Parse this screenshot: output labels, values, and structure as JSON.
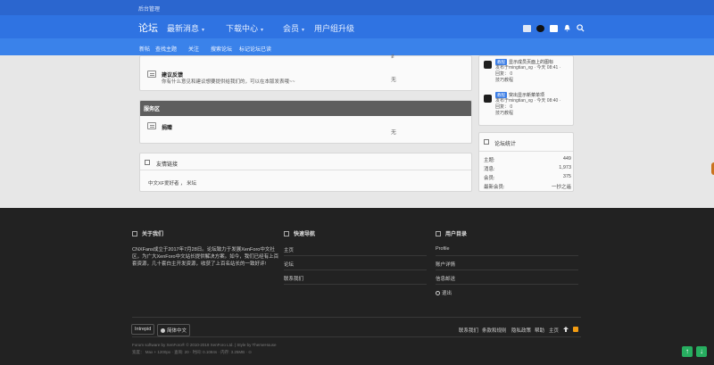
{
  "header": {
    "admin_link": "后台管理",
    "nav": [
      {
        "label": "论坛"
      },
      {
        "label": "最新消息"
      },
      {
        "label": "下载中心"
      },
      {
        "label": "会员"
      },
      {
        "label": "用户组升级"
      }
    ],
    "chev": "▾",
    "subnav": [
      "新帖",
      "查找主题",
      "关注",
      "搜索论坛",
      "标记论坛已读"
    ]
  },
  "main": {
    "node_suggest": {
      "title": "建议反馈",
      "desc": "你有什么意见和建议想要提供给我们的，可以在本版发表哦~~",
      "stat": "无"
    },
    "category_service": {
      "title": "服务区"
    },
    "node_donate": {
      "title": "捐赠",
      "stat": "无"
    },
    "friend_links": {
      "title": "友情链接",
      "links": "中文XF爱好者 ， 米坛"
    }
  },
  "sidebar": {
    "threads": [
      {
        "badge": "教程",
        "title": "显示成员页面上的图标",
        "meta1": "发布于mingtian_xg · 今天 08:41 ·",
        "meta2": "回复： 0",
        "meta3": "技巧教程"
      },
      {
        "badge": "教程",
        "title": "突出显示新菜单项",
        "meta1": "发布于mingtian_xg · 今天 08:40 ·",
        "meta2": "回复： 0",
        "meta3": "技巧教程"
      }
    ],
    "stats": {
      "title": "论坛统计",
      "rows": [
        {
          "label": "主题:",
          "value": "449"
        },
        {
          "label": "消息:",
          "value": "1,973"
        },
        {
          "label": "会员:",
          "value": "375"
        },
        {
          "label": "最新会员:",
          "value": "一抄之遥"
        }
      ]
    }
  },
  "footer": {
    "about": {
      "title": "关于我们",
      "text1": "CNXFans成立于2017年7月28日。论坛致力于发展XenForo中文社",
      "text2": "区，为广大XenForo中文站长提供解决方案。如今，我们已经有上百",
      "text3": "套资源，几十套白主开发资源，收获了上百名站长的一致好评!"
    },
    "quicknav": {
      "title": "快速导航",
      "links": [
        "主页",
        "论坛",
        "联系我们"
      ]
    },
    "usercenter": {
      "title": "用户目录",
      "links": [
        "Profile",
        "账户详情",
        "信息邮送",
        "退出"
      ]
    },
    "style_btn": "Intrepid",
    "lang_btn": "简体中文",
    "bottom_links": [
      "联系我们",
      "条款和规则",
      "隐私政策",
      "帮助",
      "主页"
    ],
    "copyright": "Forum software by XenForo® © 2010-2019 XenForo Ltd. | Style by ThemeHouse",
    "perf": "宽度： Max + 1200px · 查询: 20 · 时间: 0.1084s · 内存: 3.25MB · ⊙"
  },
  "colors": {
    "topbar": "#2b66cf",
    "navbar": "#2f73e2",
    "subbar": "#3a82ea",
    "footer": "#222222",
    "fab": "#27ae60"
  }
}
